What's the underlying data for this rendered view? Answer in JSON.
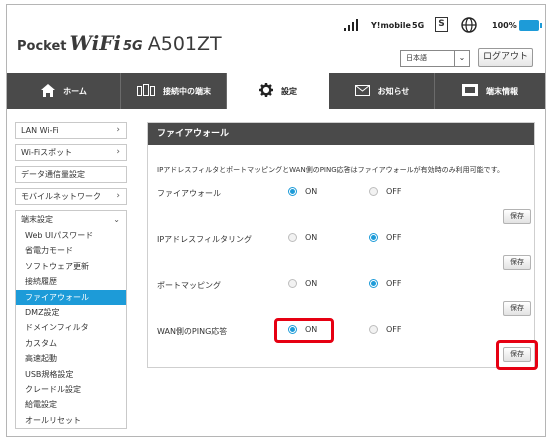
{
  "header": {
    "logo_pocket": "Pocket",
    "logo_wifi": "WiFi",
    "logo_5g": "5G",
    "logo_model": "A501ZT",
    "signal_icon": "signal-bars-icon",
    "carrier": "Y!mobile",
    "network": "5G",
    "sim_label": "S",
    "battery_pct": "100%",
    "language": "日本語",
    "logout": "ログアウト"
  },
  "nav": {
    "tabs": [
      {
        "label": "ホーム",
        "icon": "home-icon"
      },
      {
        "label": "接続中の端末",
        "icon": "devices-icon"
      },
      {
        "label": "設定",
        "icon": "gear-icon"
      },
      {
        "label": "お知らせ",
        "icon": "mail-icon"
      },
      {
        "label": "端末情報",
        "icon": "device-info-icon"
      }
    ]
  },
  "sidebar": {
    "top_items": [
      "LAN Wi-Fi",
      "Wi-Fiスポット",
      "データ通信量設定",
      "モバイルネットワーク"
    ],
    "group_label": "端末設定",
    "sub_items": [
      "Web UIパスワード",
      "省電力モード",
      "ソフトウェア更新",
      "接続履歴",
      "ファイアウォール",
      "DMZ設定",
      "ドメインフィルタ",
      "カスタム",
      "高速起動",
      "USB規格設定",
      "クレードル設定",
      "給電設定",
      "オールリセット"
    ]
  },
  "content": {
    "title": "ファイアウォール",
    "description": "IPアドレスフィルタとポートマッピングとWAN側のPING応答はファイアウォールが有効時のみ利用可能です。",
    "rows": [
      {
        "label": "ファイアウォール",
        "on": "ON",
        "off": "OFF",
        "selected": "ON",
        "save": "保存"
      },
      {
        "label": "IPアドレスフィルタリング",
        "on": "ON",
        "off": "OFF",
        "selected": "OFF",
        "save": "保存"
      },
      {
        "label": "ポートマッピング",
        "on": "ON",
        "off": "OFF",
        "selected": "OFF",
        "save": "保存"
      },
      {
        "label": "WAN側のPING応答",
        "on": "ON",
        "off": "OFF",
        "selected": "ON",
        "save": "保存"
      }
    ]
  },
  "colors": {
    "accent": "#1d9bd8",
    "nav_bg": "#4a4a4a",
    "highlight": "#e60012"
  }
}
